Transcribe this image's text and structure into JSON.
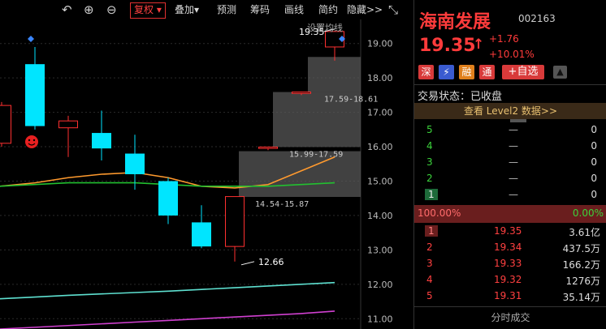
{
  "toolbar": {
    "fuquan": "复权",
    "diejia": "叠加",
    "yuce": "预测",
    "chouma": "筹码",
    "huaxian": "画线",
    "jianyue": "简约",
    "yincang": "隐藏>>"
  },
  "chart_header": {
    "ma_setting": "设置均线"
  },
  "stock": {
    "name": "海南发展",
    "code": "002163",
    "price": "19.35",
    "arrow": "↑",
    "change": "+1.76",
    "change_pct": "+10.01%",
    "badges": [
      "深",
      "⚡",
      "融",
      "通"
    ],
    "watch_button": "+自选",
    "status_label": "交易状态：已收盘",
    "level2": "查看 Level2 数据>>"
  },
  "sell_orders": [
    {
      "level": "5",
      "price": "—",
      "volume": "0"
    },
    {
      "level": "4",
      "price": "—",
      "volume": "0"
    },
    {
      "level": "3",
      "price": "—",
      "volume": "0"
    },
    {
      "level": "2",
      "price": "—",
      "volume": "0"
    },
    {
      "level": "1",
      "price": "—",
      "volume": "0"
    }
  ],
  "ratio": {
    "left": "100.00%",
    "right": "0.00%"
  },
  "buy_orders": [
    {
      "level": "1",
      "price": "19.35",
      "volume": "3.61亿"
    },
    {
      "level": "2",
      "price": "19.34",
      "volume": "437.5万"
    },
    {
      "level": "3",
      "price": "19.33",
      "volume": "166.2万"
    },
    {
      "level": "4",
      "price": "19.32",
      "volume": "1276万"
    },
    {
      "level": "5",
      "price": "19.31",
      "volume": "35.14万"
    }
  ],
  "footer": {
    "tick_detail": "分时成交"
  },
  "colors": {
    "up": "#ff3030",
    "down": "#00e5ff",
    "ma1": "#ff9a2e",
    "ma2": "#22c030",
    "ma3": "#5ee0d0",
    "ma4": "#d040d0"
  },
  "chart_data": {
    "type": "candlestick",
    "ylim": [
      10.7,
      19.7
    ],
    "y_ticks": [
      "19.00",
      "18.00",
      "17.00",
      "16.00",
      "15.00",
      "14.00",
      "13.00",
      "12.00",
      "11.00"
    ],
    "candles": [
      {
        "open": 16.1,
        "close": 17.2,
        "high": 17.3,
        "low": 16.0,
        "dir": "up"
      },
      {
        "open": 18.4,
        "close": 16.6,
        "high": 18.9,
        "low": 16.5,
        "dir": "down"
      },
      {
        "open": 16.55,
        "close": 16.75,
        "high": 16.9,
        "low": 15.7,
        "dir": "up"
      },
      {
        "open": 16.4,
        "close": 15.95,
        "high": 17.05,
        "low": 15.6,
        "dir": "down"
      },
      {
        "open": 15.8,
        "close": 15.2,
        "high": 16.35,
        "low": 14.75,
        "dir": "down"
      },
      {
        "open": 15.0,
        "close": 14.0,
        "high": 15.1,
        "low": 13.75,
        "dir": "down"
      },
      {
        "open": 13.8,
        "close": 13.1,
        "high": 14.3,
        "low": 13.05,
        "dir": "down"
      },
      {
        "open": 13.1,
        "close": 14.55,
        "high": 14.55,
        "low": 12.66,
        "dir": "up"
      },
      {
        "open": 15.95,
        "close": 15.99,
        "high": 16.0,
        "low": 15.9,
        "dir": "up"
      },
      {
        "open": 17.55,
        "close": 17.59,
        "high": 17.6,
        "low": 17.5,
        "dir": "up"
      },
      {
        "open": 18.9,
        "close": 19.35,
        "high": 19.35,
        "low": 18.5,
        "dir": "up"
      }
    ],
    "price_bands": [
      {
        "low": 14.54,
        "high": 15.87,
        "label": "14.54-15.87"
      },
      {
        "low": 15.99,
        "high": 17.59,
        "label": "15.99-17.59"
      },
      {
        "low": 17.59,
        "high": 18.61,
        "label": "17.59-18.61"
      }
    ],
    "annotations": [
      {
        "label": "19.35",
        "value": 19.35
      },
      {
        "label": "12.66",
        "value": 12.66
      }
    ],
    "ma_lines": [
      {
        "color": "orange",
        "values": [
          14.85,
          14.95,
          15.1,
          15.2,
          15.25,
          15.1,
          14.85,
          14.8,
          14.9,
          15.3,
          15.7
        ]
      },
      {
        "color": "green",
        "values": [
          14.85,
          14.9,
          14.95,
          14.95,
          14.95,
          14.9,
          14.85,
          14.85,
          14.85,
          14.9,
          14.95
        ]
      },
      {
        "color": "cyan",
        "values": [
          11.58,
          11.63,
          11.68,
          11.72,
          11.76,
          11.8,
          11.85,
          11.9,
          11.95,
          12.0,
          12.05
        ]
      },
      {
        "color": "magenta",
        "values": [
          10.7,
          10.75,
          10.8,
          10.85,
          10.9,
          10.95,
          11.0,
          11.05,
          11.1,
          11.15,
          11.22
        ]
      }
    ]
  }
}
